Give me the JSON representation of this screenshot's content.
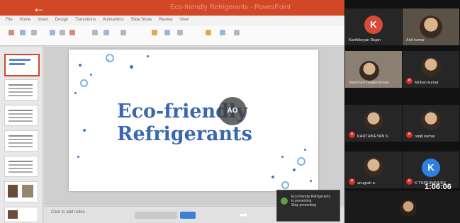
{
  "window": {
    "title": "Eco-friendly Refrigerants - PowerPoint",
    "back_icon": "arrow-left-icon",
    "ribbon_tabs": [
      "File",
      "Home",
      "Insert",
      "Design",
      "Transitions",
      "Animations",
      "Slide Show",
      "Review",
      "View"
    ]
  },
  "slide": {
    "title_line1": "Eco-friendly",
    "title_line2": "Refrigerants",
    "overlay_text": "AO",
    "accent_color": "#3a67b1"
  },
  "thumbnails": [
    {
      "title": "Eco-friendly Refrigerants"
    },
    {
      "title": "Refrigerants"
    },
    {
      "title": ""
    },
    {
      "title": ""
    },
    {
      "title": "What are"
    },
    {
      "title": ""
    },
    {
      "title": ""
    }
  ],
  "statusbar": {
    "notes_label": "Click to add notes"
  },
  "toast": {
    "icon": "meet-icon",
    "line1": "Eco-friendly Refrigerants",
    "line2": "is presenting",
    "line3": "Stop presenting"
  },
  "participants": [
    {
      "name": "Karthikeyan Rajan",
      "initial": "K",
      "color": "#d84a3a",
      "type": "avatar"
    },
    {
      "name": "Anil kumar",
      "initial": "",
      "color": "",
      "type": "video"
    },
    {
      "name": "Vaishnavi Balakrishnan",
      "initial": "",
      "color": "",
      "type": "video"
    },
    {
      "name": "Mohan kumar",
      "initial": "",
      "color": "",
      "type": "photo"
    },
    {
      "name": "KARTHIKEYAN S",
      "initial": "",
      "color": "",
      "type": "photo"
    },
    {
      "name": "ranjit kumar",
      "initial": "",
      "color": "",
      "type": "photo"
    },
    {
      "name": "anugrah a",
      "initial": "",
      "color": "",
      "type": "photo"
    },
    {
      "name": "K THIRUNAVUKK",
      "initial": "K",
      "color": "#2d7fe0",
      "type": "avatar"
    }
  ],
  "clock": "1:06:06",
  "mic_icon": "mic-off-icon",
  "share_icon": "share-icon"
}
